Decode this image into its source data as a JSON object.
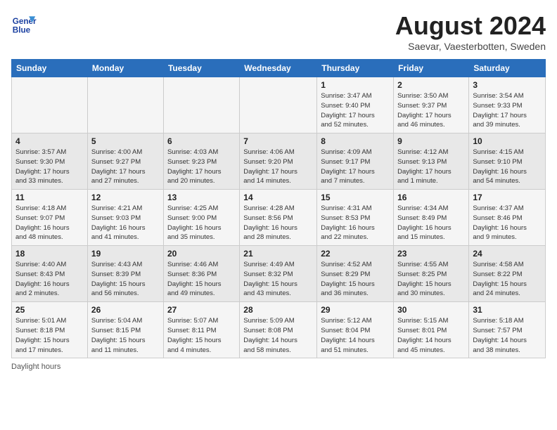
{
  "header": {
    "logo_line1": "General",
    "logo_line2": "Blue",
    "title": "August 2024",
    "subtitle": "Saevar, Vaesterbotten, Sweden"
  },
  "days_of_week": [
    "Sunday",
    "Monday",
    "Tuesday",
    "Wednesday",
    "Thursday",
    "Friday",
    "Saturday"
  ],
  "weeks": [
    [
      {
        "day": "",
        "info": ""
      },
      {
        "day": "",
        "info": ""
      },
      {
        "day": "",
        "info": ""
      },
      {
        "day": "",
        "info": ""
      },
      {
        "day": "1",
        "info": "Sunrise: 3:47 AM\nSunset: 9:40 PM\nDaylight: 17 hours\nand 52 minutes."
      },
      {
        "day": "2",
        "info": "Sunrise: 3:50 AM\nSunset: 9:37 PM\nDaylight: 17 hours\nand 46 minutes."
      },
      {
        "day": "3",
        "info": "Sunrise: 3:54 AM\nSunset: 9:33 PM\nDaylight: 17 hours\nand 39 minutes."
      }
    ],
    [
      {
        "day": "4",
        "info": "Sunrise: 3:57 AM\nSunset: 9:30 PM\nDaylight: 17 hours\nand 33 minutes."
      },
      {
        "day": "5",
        "info": "Sunrise: 4:00 AM\nSunset: 9:27 PM\nDaylight: 17 hours\nand 27 minutes."
      },
      {
        "day": "6",
        "info": "Sunrise: 4:03 AM\nSunset: 9:23 PM\nDaylight: 17 hours\nand 20 minutes."
      },
      {
        "day": "7",
        "info": "Sunrise: 4:06 AM\nSunset: 9:20 PM\nDaylight: 17 hours\nand 14 minutes."
      },
      {
        "day": "8",
        "info": "Sunrise: 4:09 AM\nSunset: 9:17 PM\nDaylight: 17 hours\nand 7 minutes."
      },
      {
        "day": "9",
        "info": "Sunrise: 4:12 AM\nSunset: 9:13 PM\nDaylight: 17 hours\nand 1 minute."
      },
      {
        "day": "10",
        "info": "Sunrise: 4:15 AM\nSunset: 9:10 PM\nDaylight: 16 hours\nand 54 minutes."
      }
    ],
    [
      {
        "day": "11",
        "info": "Sunrise: 4:18 AM\nSunset: 9:07 PM\nDaylight: 16 hours\nand 48 minutes."
      },
      {
        "day": "12",
        "info": "Sunrise: 4:21 AM\nSunset: 9:03 PM\nDaylight: 16 hours\nand 41 minutes."
      },
      {
        "day": "13",
        "info": "Sunrise: 4:25 AM\nSunset: 9:00 PM\nDaylight: 16 hours\nand 35 minutes."
      },
      {
        "day": "14",
        "info": "Sunrise: 4:28 AM\nSunset: 8:56 PM\nDaylight: 16 hours\nand 28 minutes."
      },
      {
        "day": "15",
        "info": "Sunrise: 4:31 AM\nSunset: 8:53 PM\nDaylight: 16 hours\nand 22 minutes."
      },
      {
        "day": "16",
        "info": "Sunrise: 4:34 AM\nSunset: 8:49 PM\nDaylight: 16 hours\nand 15 minutes."
      },
      {
        "day": "17",
        "info": "Sunrise: 4:37 AM\nSunset: 8:46 PM\nDaylight: 16 hours\nand 9 minutes."
      }
    ],
    [
      {
        "day": "18",
        "info": "Sunrise: 4:40 AM\nSunset: 8:43 PM\nDaylight: 16 hours\nand 2 minutes."
      },
      {
        "day": "19",
        "info": "Sunrise: 4:43 AM\nSunset: 8:39 PM\nDaylight: 15 hours\nand 56 minutes."
      },
      {
        "day": "20",
        "info": "Sunrise: 4:46 AM\nSunset: 8:36 PM\nDaylight: 15 hours\nand 49 minutes."
      },
      {
        "day": "21",
        "info": "Sunrise: 4:49 AM\nSunset: 8:32 PM\nDaylight: 15 hours\nand 43 minutes."
      },
      {
        "day": "22",
        "info": "Sunrise: 4:52 AM\nSunset: 8:29 PM\nDaylight: 15 hours\nand 36 minutes."
      },
      {
        "day": "23",
        "info": "Sunrise: 4:55 AM\nSunset: 8:25 PM\nDaylight: 15 hours\nand 30 minutes."
      },
      {
        "day": "24",
        "info": "Sunrise: 4:58 AM\nSunset: 8:22 PM\nDaylight: 15 hours\nand 24 minutes."
      }
    ],
    [
      {
        "day": "25",
        "info": "Sunrise: 5:01 AM\nSunset: 8:18 PM\nDaylight: 15 hours\nand 17 minutes."
      },
      {
        "day": "26",
        "info": "Sunrise: 5:04 AM\nSunset: 8:15 PM\nDaylight: 15 hours\nand 11 minutes."
      },
      {
        "day": "27",
        "info": "Sunrise: 5:07 AM\nSunset: 8:11 PM\nDaylight: 15 hours\nand 4 minutes."
      },
      {
        "day": "28",
        "info": "Sunrise: 5:09 AM\nSunset: 8:08 PM\nDaylight: 14 hours\nand 58 minutes."
      },
      {
        "day": "29",
        "info": "Sunrise: 5:12 AM\nSunset: 8:04 PM\nDaylight: 14 hours\nand 51 minutes."
      },
      {
        "day": "30",
        "info": "Sunrise: 5:15 AM\nSunset: 8:01 PM\nDaylight: 14 hours\nand 45 minutes."
      },
      {
        "day": "31",
        "info": "Sunrise: 5:18 AM\nSunset: 7:57 PM\nDaylight: 14 hours\nand 38 minutes."
      }
    ]
  ],
  "footer": {
    "note": "Daylight hours"
  }
}
